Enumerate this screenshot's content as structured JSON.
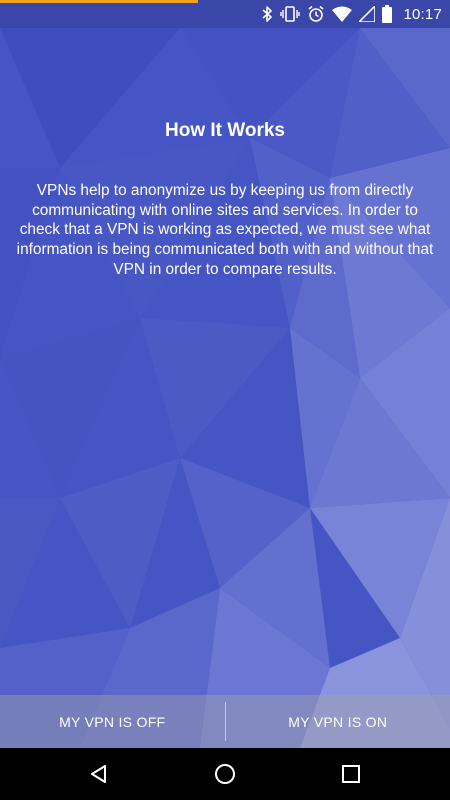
{
  "status_bar": {
    "time": "10:17",
    "progress_fraction": 0.44,
    "progress_color": "#f2a51a",
    "icons": [
      "bluetooth-icon",
      "vibrate-icon",
      "alarm-icon",
      "wifi-icon",
      "signal-icon",
      "battery-icon"
    ]
  },
  "main": {
    "title": "How It Works",
    "body": "VPNs help to anonymize us by keeping us from directly communicating with online sites and services. In order to check that a VPN is working as expected, we must see what information is being communicated both with and without that VPN in order to compare results."
  },
  "buttons": {
    "vpn_off_label": "MY VPN IS OFF",
    "vpn_on_label": "MY VPN IS ON"
  },
  "nav_bar": {
    "icons": [
      "back-icon",
      "home-icon",
      "recents-icon"
    ]
  },
  "colors": {
    "background": "#4655c4",
    "accent": "#f2a51a"
  }
}
